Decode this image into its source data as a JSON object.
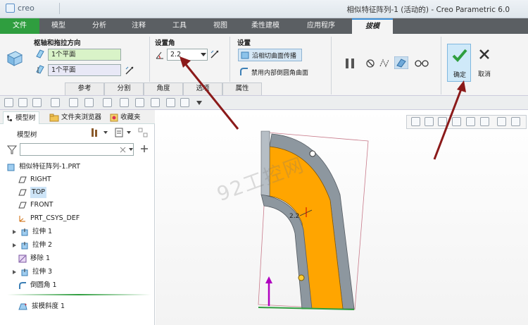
{
  "app": {
    "logo_text": "creo",
    "window_title": "相似特征阵列-1 (活动的) - Creo Parametric 6.0"
  },
  "menu": {
    "items": [
      "文件",
      "模型",
      "分析",
      "注释",
      "工具",
      "视图",
      "柔性建模",
      "应用程序",
      "拔模"
    ],
    "active": "拔模"
  },
  "ribbon": {
    "group_hinge": "枢轴和拖拉方向",
    "hinge_value": "1个平面",
    "pull_value": "1个平面",
    "group_angle": "设置角",
    "angle_value": "2.2",
    "group_settings": "设置",
    "tangent_propagate": "沿相切曲面传播",
    "disable_round": "禁用内部倒圆角曲面",
    "tabs": [
      "参考",
      "分割",
      "角度",
      "选项",
      "属性"
    ],
    "ok_label": "确定",
    "cancel_label": "取消",
    "colors": {
      "ok_check": "#2f9e3f",
      "accent_tab": "#3d8fd6"
    }
  },
  "panel": {
    "tabs": [
      "模型树",
      "文件夹浏览器",
      "收藏夹"
    ],
    "tree_title": "模型树",
    "filter_placeholder": "",
    "tree": [
      {
        "label": "相似特征阵列-1.PRT",
        "icon": "part-icon"
      },
      {
        "label": "RIGHT",
        "icon": "datum-plane-icon"
      },
      {
        "label": "TOP",
        "icon": "datum-plane-icon",
        "selected": true
      },
      {
        "label": "FRONT",
        "icon": "datum-plane-icon"
      },
      {
        "label": "PRT_CSYS_DEF",
        "icon": "csys-icon"
      },
      {
        "label": "拉伸 1",
        "icon": "extrude-icon"
      },
      {
        "label": "拉伸 2",
        "icon": "extrude-icon"
      },
      {
        "label": "移除 1",
        "icon": "remove-icon"
      },
      {
        "label": "拉伸 3",
        "icon": "extrude-icon"
      },
      {
        "label": "倒圆角 1",
        "icon": "round-icon"
      },
      {
        "label": "拔模斜度 1",
        "icon": "draft-icon"
      }
    ]
  },
  "viewport": {
    "angle_label": "2.2",
    "watermark": "92工控网",
    "colors": {
      "draft_surface": "#ffa500",
      "arrow": "#8b1a1a",
      "pull_arrow": "#b000c0"
    }
  }
}
